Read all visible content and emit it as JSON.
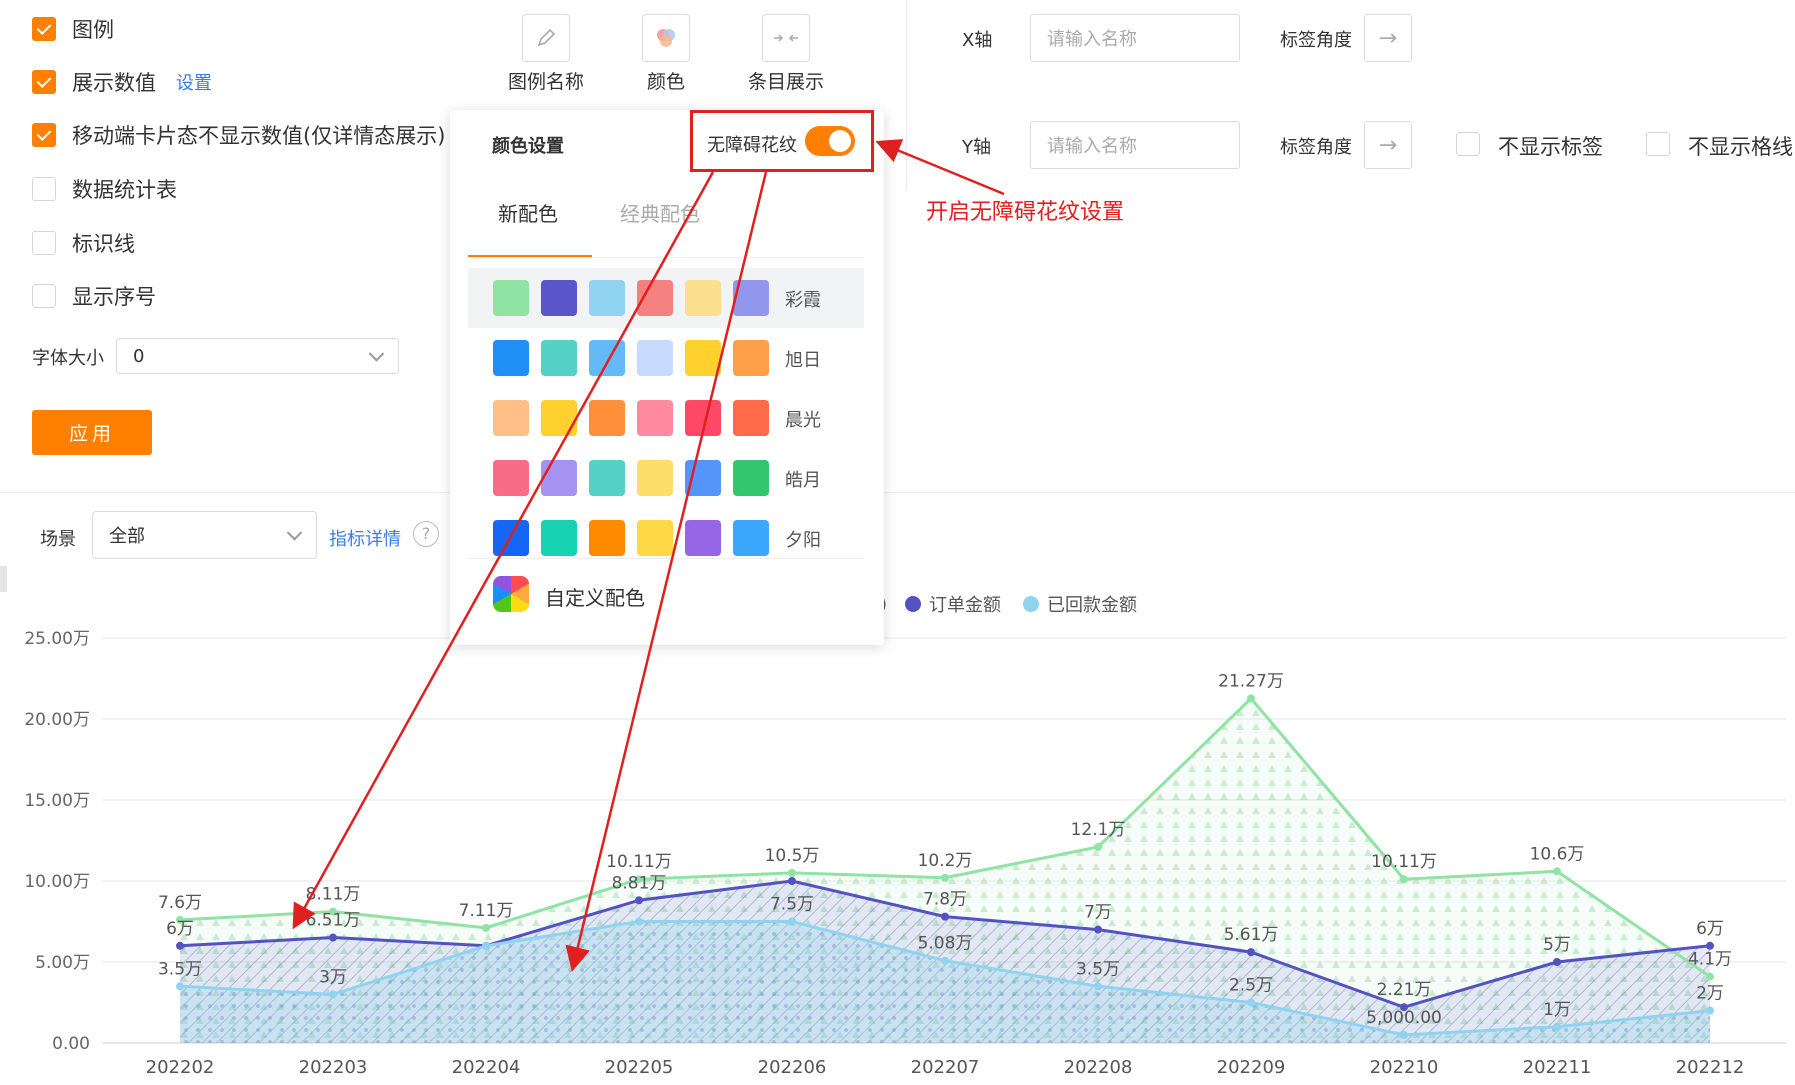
{
  "options": [
    {
      "label": "图例",
      "checked": true
    },
    {
      "label": "展示数值",
      "checked": true,
      "link": "设置"
    },
    {
      "label": "移动端卡片态不显示数值(仅详情态展示)",
      "checked": true
    },
    {
      "label": "数据统计表",
      "checked": false
    },
    {
      "label": "标识线",
      "checked": false
    },
    {
      "label": "显示序号",
      "checked": false
    }
  ],
  "font_size": {
    "label": "字体大小",
    "value": "0"
  },
  "apply_label": "应用",
  "tools": [
    {
      "label": "图例名称",
      "icon": "pencil-icon"
    },
    {
      "label": "颜色",
      "icon": "color-palette-icon"
    },
    {
      "label": "条目展示",
      "icon": "collapse-arrows-icon"
    }
  ],
  "axes": {
    "x_label": "X轴",
    "y_label": "Y轴",
    "name_placeholder": "请输入名称",
    "angle_label": "标签角度",
    "hide_labels": "不显示标签",
    "hide_grid": "不显示格线"
  },
  "popup": {
    "title": "颜色设置",
    "accessibility_label": "无障碍花纹",
    "accessibility_on": true,
    "tabs": [
      "新配色",
      "经典配色"
    ],
    "active_tab": 0,
    "schemes": [
      {
        "name": "彩霞",
        "colors": [
          "#8fe3a3",
          "#5b56c9",
          "#8fd3f0",
          "#f58080",
          "#fde08e",
          "#9296ec"
        ]
      },
      {
        "name": "旭日",
        "colors": [
          "#1f8ef5",
          "#55d1c6",
          "#63baf7",
          "#c6dbfd",
          "#fed12e",
          "#ff9f4a"
        ]
      },
      {
        "name": "晨光",
        "colors": [
          "#ffbf86",
          "#fed12e",
          "#ff8f3a",
          "#ff8aa0",
          "#ff4866",
          "#ff6a48"
        ]
      },
      {
        "name": "皓月",
        "colors": [
          "#f96c87",
          "#a593f1",
          "#55d1c6",
          "#fede6a",
          "#5395fa",
          "#33c66f"
        ]
      },
      {
        "name": "夕阳",
        "colors": [
          "#1565f7",
          "#17d1b3",
          "#ff8a00",
          "#fed845",
          "#9766e6",
          "#3ba7ff"
        ]
      }
    ],
    "custom_label": "自定义配色"
  },
  "annotation": "开启无障碍花纹设置",
  "scene": {
    "label": "场景",
    "value": "全部",
    "link": "指标详情",
    "help": "?"
  },
  "legend": [
    {
      "name": "订单金额",
      "color": "#5352c0"
    },
    {
      "name": "已回款金额",
      "color": "#8fd3f0"
    }
  ],
  "chart_data": {
    "type": "area",
    "categories": [
      "202202",
      "202203",
      "202204",
      "202205",
      "202206",
      "202207",
      "202208",
      "202209",
      "202210",
      "202211",
      "202212"
    ],
    "yticks": [
      "0.00",
      "5.00万",
      "10.00万",
      "15.00万",
      "20.00万",
      "25.00万"
    ],
    "ylim": [
      0,
      25
    ],
    "grid": true,
    "series": [
      {
        "color": "#8fe3a3",
        "values": [
          7.6,
          8.11,
          7.11,
          10.11,
          10.5,
          10.2,
          12.1,
          21.27,
          10.11,
          10.6,
          4.1
        ],
        "labels": [
          "7.6万",
          "8.11万",
          "7.11万",
          "10.11万",
          "10.5万",
          "10.2万",
          "12.1万",
          "21.27万",
          "10.11万",
          "10.6万",
          "4.1万"
        ]
      },
      {
        "name": "订单金额",
        "color": "#5352c0",
        "values": [
          6,
          6.51,
          6,
          8.81,
          10,
          7.8,
          7,
          5.61,
          2.21,
          5,
          6
        ],
        "labels": [
          "6万",
          "6.51万",
          "",
          "8.81万",
          "",
          "7.8万",
          "7万",
          "5.61万",
          "2.21万",
          "5万",
          "6万"
        ]
      },
      {
        "name": "已回款金额",
        "color": "#8fd3f0",
        "values": [
          3.5,
          3,
          6,
          7.5,
          7.5,
          5.08,
          3.5,
          2.5,
          0.5,
          1,
          2
        ],
        "labels": [
          "3.5万",
          "3万",
          "",
          "",
          "7.5万",
          "5.08万",
          "3.5万",
          "2.5万",
          "5,000.00",
          "1万",
          "2万"
        ]
      }
    ]
  }
}
